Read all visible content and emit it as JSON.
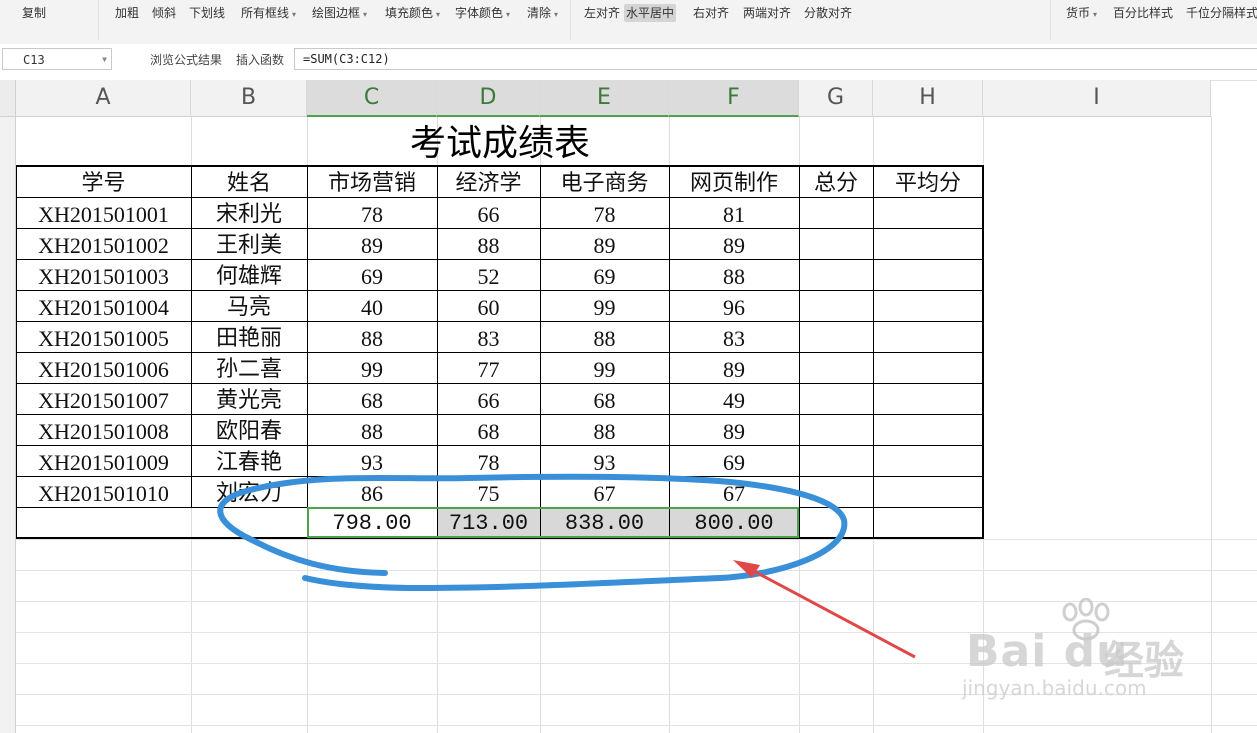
{
  "toolbar": {
    "items": [
      {
        "label": "复制",
        "caret": false,
        "active": false
      },
      {
        "label": "加粗",
        "caret": false,
        "active": false
      },
      {
        "label": "倾斜",
        "caret": false,
        "active": false
      },
      {
        "label": "下划线",
        "caret": false,
        "active": false
      },
      {
        "label": "所有框线",
        "caret": true,
        "active": false
      },
      {
        "label": "绘图边框",
        "caret": true,
        "active": false
      },
      {
        "label": "填充颜色",
        "caret": true,
        "active": false
      },
      {
        "label": "字体颜色",
        "caret": true,
        "active": false
      },
      {
        "label": "清除",
        "caret": true,
        "active": false
      },
      {
        "label": "左对齐",
        "caret": false,
        "active": false
      },
      {
        "label": "水平居中",
        "caret": false,
        "active": true
      },
      {
        "label": "右对齐",
        "caret": false,
        "active": false
      },
      {
        "label": "两端对齐",
        "caret": false,
        "active": false
      },
      {
        "label": "分散对齐",
        "caret": false,
        "active": false
      },
      {
        "label": "货币",
        "caret": true,
        "active": false
      },
      {
        "label": "百分比样式",
        "caret": false,
        "active": false
      },
      {
        "label": "千位分隔样式",
        "caret": false,
        "active": false
      }
    ]
  },
  "formula_bar": {
    "cell_ref": "C13",
    "browse_label": "浏览公式结果",
    "insert_fn_label": "插入函数",
    "formula": "=SUM(C3:C12)"
  },
  "columns": [
    "A",
    "B",
    "C",
    "D",
    "E",
    "F",
    "G",
    "H",
    "I"
  ],
  "selected_columns": [
    "C",
    "D",
    "E",
    "F"
  ],
  "sheet": {
    "title": "考试成绩表",
    "headers": [
      "学号",
      "姓名",
      "市场营销",
      "经济学",
      "电子商务",
      "网页制作",
      "总分",
      "平均分"
    ],
    "rows": [
      [
        "XH201501001",
        "宋利光",
        "78",
        "66",
        "78",
        "81"
      ],
      [
        "XH201501002",
        "王利美",
        "89",
        "88",
        "89",
        "89"
      ],
      [
        "XH201501003",
        "何雄辉",
        "69",
        "52",
        "69",
        "88"
      ],
      [
        "XH201501004",
        "马亮",
        "40",
        "60",
        "99",
        "96"
      ],
      [
        "XH201501005",
        "田艳丽",
        "88",
        "83",
        "88",
        "83"
      ],
      [
        "XH201501006",
        "孙二喜",
        "99",
        "77",
        "99",
        "89"
      ],
      [
        "XH201501007",
        "黄光亮",
        "68",
        "66",
        "68",
        "49"
      ],
      [
        "XH201501008",
        "欧阳春",
        "88",
        "68",
        "88",
        "89"
      ],
      [
        "XH201501009",
        "江春艳",
        "93",
        "78",
        "93",
        "69"
      ],
      [
        "XH201501010",
        "刘宏力",
        "86",
        "75",
        "67",
        "67"
      ]
    ],
    "totals": [
      "798.00",
      "713.00",
      "838.00",
      "800.00"
    ]
  },
  "annotation": {
    "circle_color": "#3a90d8",
    "arrow_color": "#e04848"
  },
  "watermark": {
    "brand": "Bai du",
    "cn": "经验",
    "url": "jingyan.baidu.com"
  }
}
